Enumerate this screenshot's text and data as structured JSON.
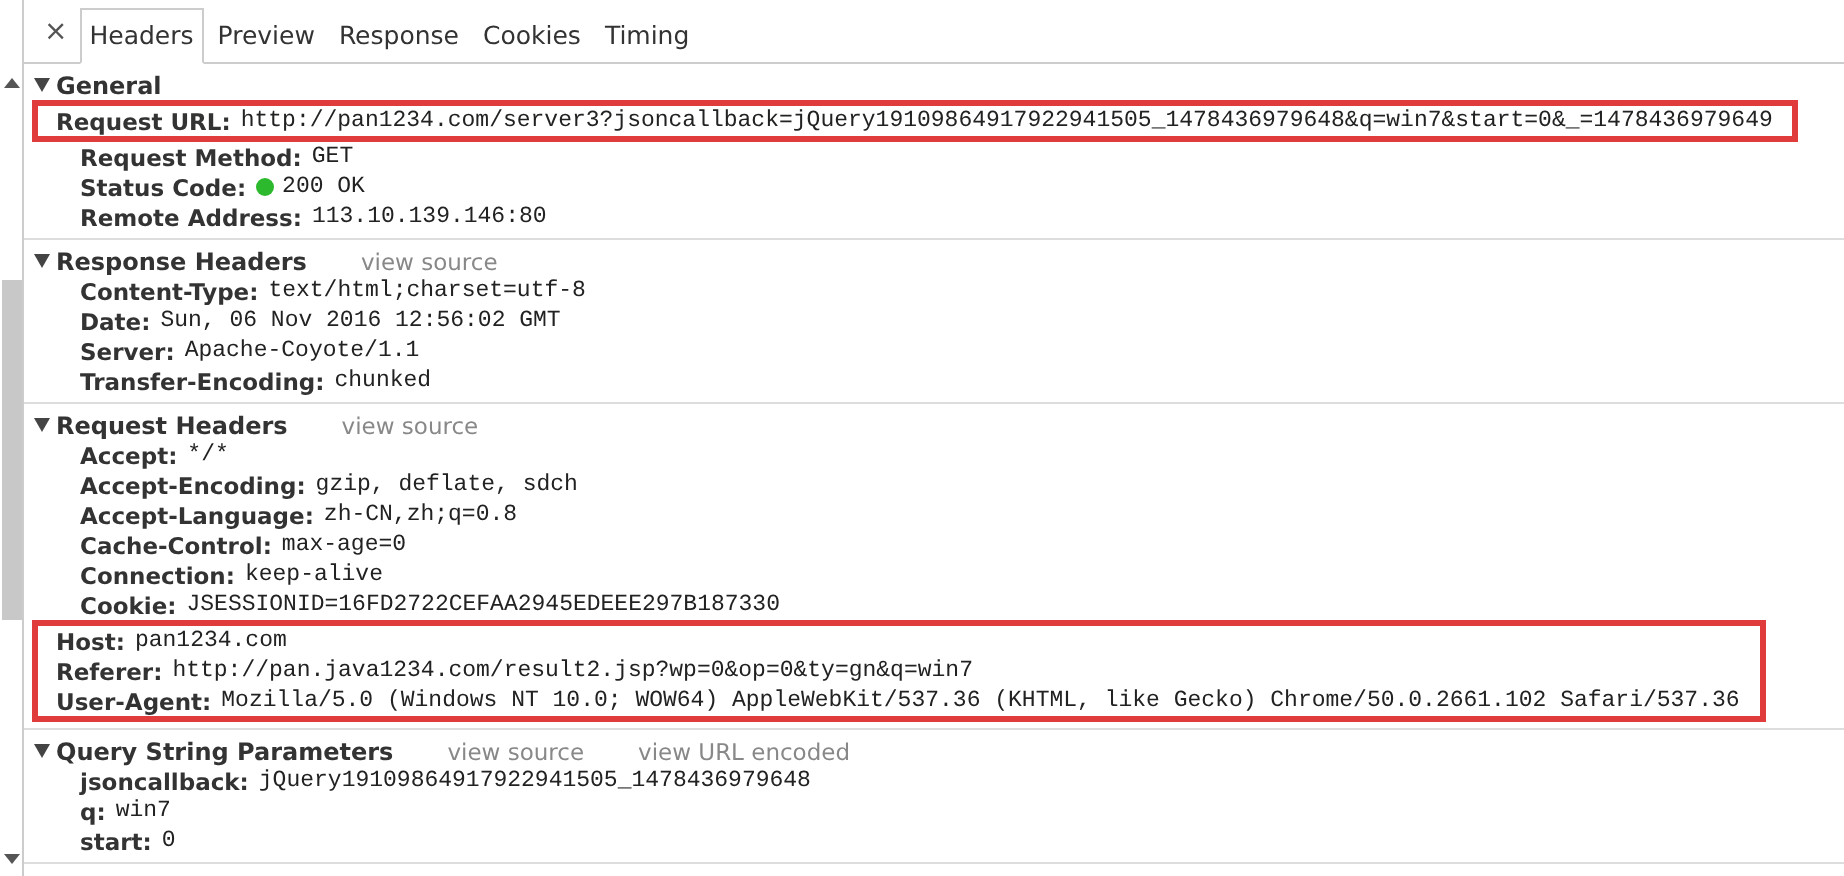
{
  "close_label": "×",
  "tabs": [
    {
      "label": "Headers",
      "selected": true
    },
    {
      "label": "Preview",
      "selected": false
    },
    {
      "label": "Response",
      "selected": false
    },
    {
      "label": "Cookies",
      "selected": false
    },
    {
      "label": "Timing",
      "selected": false
    }
  ],
  "sections": [
    {
      "title": "General",
      "expanded": true,
      "rows": [
        {
          "kind": "text",
          "name": "Request URL:",
          "value": "http://pan1234.com/server3?jsoncallback=jQuery19109864917922941505_1478436979648&q=win7&start=0&_=1478436979649",
          "highlighted": true
        },
        {
          "kind": "text",
          "name": "Request Method:",
          "value": "GET",
          "highlighted": false
        },
        {
          "kind": "status",
          "name": "Status Code:",
          "value": "200 OK",
          "highlighted": false
        },
        {
          "kind": "text",
          "name": "Remote Address:",
          "value": "113.10.139.146:80",
          "highlighted": false
        }
      ]
    },
    {
      "title": "Response Headers",
      "expanded": true,
      "links": [
        "view source"
      ],
      "rows": [
        {
          "kind": "text",
          "name": "Content-Type:",
          "value": "text/html;charset=utf-8",
          "highlighted": false
        },
        {
          "kind": "text",
          "name": "Date:",
          "value": "Sun, 06 Nov 2016 12:56:02 GMT",
          "highlighted": false
        },
        {
          "kind": "text",
          "name": "Server:",
          "value": "Apache-Coyote/1.1",
          "highlighted": false
        },
        {
          "kind": "text",
          "name": "Transfer-Encoding:",
          "value": "chunked",
          "highlighted": false
        }
      ]
    },
    {
      "title": "Request Headers",
      "expanded": true,
      "links": [
        "view source"
      ],
      "rows": [
        {
          "kind": "text",
          "name": "Accept:",
          "value": "*/*",
          "highlighted": false
        },
        {
          "kind": "text",
          "name": "Accept-Encoding:",
          "value": "gzip, deflate, sdch",
          "highlighted": false
        },
        {
          "kind": "text",
          "name": "Accept-Language:",
          "value": "zh-CN,zh;q=0.8",
          "highlighted": false
        },
        {
          "kind": "text",
          "name": "Cache-Control:",
          "value": "max-age=0",
          "highlighted": false
        },
        {
          "kind": "text",
          "name": "Connection:",
          "value": "keep-alive",
          "highlighted": false
        },
        {
          "kind": "text",
          "name": "Cookie:",
          "value": "JSESSIONID=16FD2722CEFAA2945EDEEE297B187330",
          "highlighted": false
        },
        {
          "kind": "text",
          "name": "Host:",
          "value": "pan1234.com",
          "highlighted": true
        },
        {
          "kind": "text",
          "name": "Referer:",
          "value": "http://pan.java1234.com/result2.jsp?wp=0&op=0&ty=gn&q=win7",
          "highlighted": true
        },
        {
          "kind": "text",
          "name": "User-Agent:",
          "value": "Mozilla/5.0 (Windows NT 10.0; WOW64) AppleWebKit/537.36 (KHTML, like Gecko) Chrome/50.0.2661.102 Safari/537.36",
          "highlighted": true
        }
      ]
    },
    {
      "title": "Query String Parameters",
      "expanded": true,
      "links": [
        "view source",
        "view URL encoded"
      ],
      "rows": [
        {
          "kind": "text",
          "name": "jsoncallback:",
          "value": "jQuery19109864917922941505_1478436979648",
          "highlighted": false
        },
        {
          "kind": "text",
          "name": "q:",
          "value": "win7",
          "highlighted": false
        },
        {
          "kind": "text",
          "name": "start:",
          "value": "0",
          "highlighted": false
        }
      ]
    }
  ]
}
